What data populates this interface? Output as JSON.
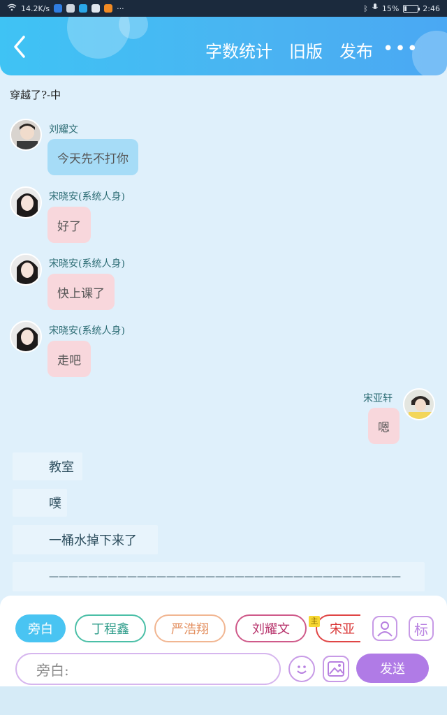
{
  "status_bar": {
    "speed": "14.2K/s",
    "battery": "15%",
    "battery_level": 0.15,
    "time": "2:46"
  },
  "header": {
    "actions": [
      "字数统计",
      "旧版",
      "发布"
    ],
    "more": "•••"
  },
  "scene_title": "穿越了?-中",
  "messages": [
    {
      "name": "刘耀文",
      "text": "今天先不打你",
      "bubble": "blue"
    },
    {
      "name": "宋晓安(系统人身)",
      "text": "好了",
      "bubble": "pink"
    },
    {
      "name": "宋晓安(系统人身)",
      "text": "快上课了",
      "bubble": "pink"
    },
    {
      "name": "宋晓安(系统人身)",
      "text": "走吧",
      "bubble": "pink"
    },
    {
      "name": "宋亚轩",
      "text": "嗯",
      "bubble": "pink",
      "side": "right"
    }
  ],
  "narration": [
    "教室",
    "噗",
    "一桶水掉下来了",
    "————————————————————————————————————"
  ],
  "roles": {
    "aside": "旁白",
    "ding": "丁程鑫",
    "yan": "严浩翔",
    "liu": "刘耀文",
    "song": "宋亚",
    "main_tag": "主"
  },
  "input": {
    "placeholder": "旁白:"
  },
  "send": "发送",
  "colors": {
    "header": "#4ab3f2",
    "bubble_blue": "#a6dcf7",
    "bubble_pink": "#f8d7dc",
    "send": "#b07be6"
  }
}
